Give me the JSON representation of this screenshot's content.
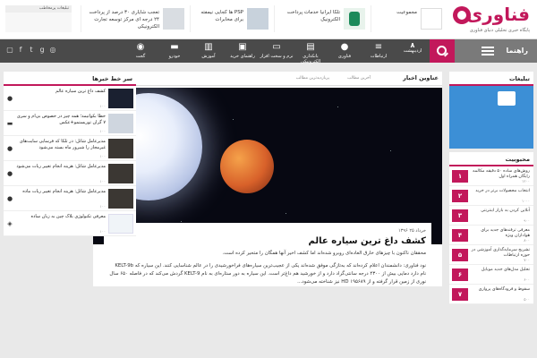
{
  "brand": {
    "name": "فناوری",
    "tagline": "پایگاه خبری تحلیلی دنیای فناوری"
  },
  "promos": [
    {
      "text": "مجموعیت",
      "sub": ""
    },
    {
      "text": "تلکا ایرانیا خدمات پرداخت الکترونیک",
      "sub": ""
    },
    {
      "text": "PSP ها کجایی نیمفته برای مخابرات",
      "sub": ""
    },
    {
      "text": "تعجب شایاری ۳۰ درصد از پرداخت ۲۴ درجه ای مرکز توسعه تجارت الکترونیکی",
      "sub": ""
    }
  ],
  "top_left": {
    "header": "تبلیغات پرمخاطب"
  },
  "nav": {
    "menu_label": "راهنما",
    "date_day": "۸",
    "date_month": "اردیبهشت",
    "items": [
      {
        "label": "ارتباطات",
        "icon": "signal-icon"
      },
      {
        "label": "فناوری",
        "icon": "user-icon"
      },
      {
        "label": "بانکداری الکترونیکی",
        "icon": "cards-icon"
      },
      {
        "label": "نرم و سخت افزار",
        "icon": "laptop-icon"
      },
      {
        "label": "راهنمای خرید",
        "icon": "cart-icon"
      },
      {
        "label": "آموزش",
        "icon": "book-icon"
      },
      {
        "label": "خودرو",
        "icon": "car-icon"
      },
      {
        "label": "گجت",
        "icon": "camera-icon"
      }
    ]
  },
  "right": {
    "ads_title": "تبلیغات",
    "popular_title": "محبوبیت",
    "popular": [
      {
        "num": "۱",
        "text": "روش‌های ساده ۵۰ دقیقه مکالمه رایگان همراه اول",
        "meta": "۱۲۰۰"
      },
      {
        "num": "۲",
        "text": "انتخاب محصولات برتر در خرید",
        "meta": "۱۰۰۰"
      },
      {
        "num": "۳",
        "text": "آنلاین کردن به بازار اینترنتی",
        "meta": "۹۰۰"
      },
      {
        "num": "۴",
        "text": "معرفی ترفندهای جدید برای هواداران ویژه",
        "meta": "۸۰۰"
      },
      {
        "num": "۵",
        "text": "تشریح سرمایه‌گذاری آموزشی در حوزه ارتباطات",
        "meta": "۷۰۰"
      },
      {
        "num": "۶",
        "text": "تحلیل مدل‌های جدید موبایل",
        "meta": "۶۰۰"
      },
      {
        "num": "۷",
        "text": "سقوط و فرودگاه‌های پروازی",
        "meta": "۵۰۰"
      }
    ]
  },
  "main": {
    "tab_main": "عناوین اخبار",
    "tab_2": "آخرین مطالب",
    "tab_3": "پربازدیدترین مطالب",
    "article": {
      "date": "خرداد ۲۵ ۱۳۹۶",
      "title": "کشف داغ ترین سیاره عالم",
      "lead": "محققان ناکنون با چیزهای خارق العاده‌ای روبرو شده‌اند اما کشف اخیر آنها همگان را متحیر کرده است.",
      "body": "نود فناوری: دانشمندان اعلام کرده‌اند که به‌تازگی موفق شده‌اند یکی از عجیب‌ترین سیاره‌های فراخورشیدی را در عالم شناسایی کنند. این سیاره که KELT-9b نام دارد دمایی بیش از ۴۳۰۰ درجه سانتی‌گراد دارد و از خورشید هم داغ‌تر است. این سیاره به دور ستاره‌ای به نام KELT-9 گردش می‌کند که در فاصله ۶۵۰ سال نوری از زمین قرار گرفته و از HD ۱۹۵۶۸۹ نیز شناخته می‌شود..."
    }
  },
  "left": {
    "title": "سر خط خبرها",
    "items": [
      {
        "title": "کشف داغ ترین سیاره عالم",
        "meta": "۱۰۰",
        "icon": "person-icon",
        "thumb": "#1a2030"
      },
      {
        "title": "خطا بکواتیمد؛ همه چیز در خصوص بی‌ام و سری ۷ گران توریستمو+عکس",
        "meta": "۱۰۰",
        "icon": "car-icon",
        "thumb": "#cfd6df"
      },
      {
        "title": "مدیرعامل شاتل: در تلکا که فرسایی سایت‌های غیرمجاز را شیرور ماه بسته می‌شود",
        "meta": "۱۰۰",
        "icon": "person-icon",
        "thumb": "#3b3733"
      },
      {
        "title": "مدیرعامل شاتل: هزینه انجام تغییر ربات می‌شود",
        "meta": "۱۰۰",
        "icon": "person-icon",
        "thumb": "#3b3733"
      },
      {
        "title": "مدیرعامل شاتل: هزینه انجام تغییر ربات ماده",
        "meta": "۱۰۰",
        "icon": "person-icon",
        "thumb": "#3b3733"
      },
      {
        "title": "معرفی تکنولوژی بلاک چین به زبان ساده",
        "meta": "۱۰۰",
        "icon": "network-icon",
        "thumb": "#f0f4f8"
      }
    ]
  },
  "colors": {
    "accent": "#c2185b",
    "nav": "#4a4a4a",
    "ad_blue": "#3c8fd6"
  }
}
